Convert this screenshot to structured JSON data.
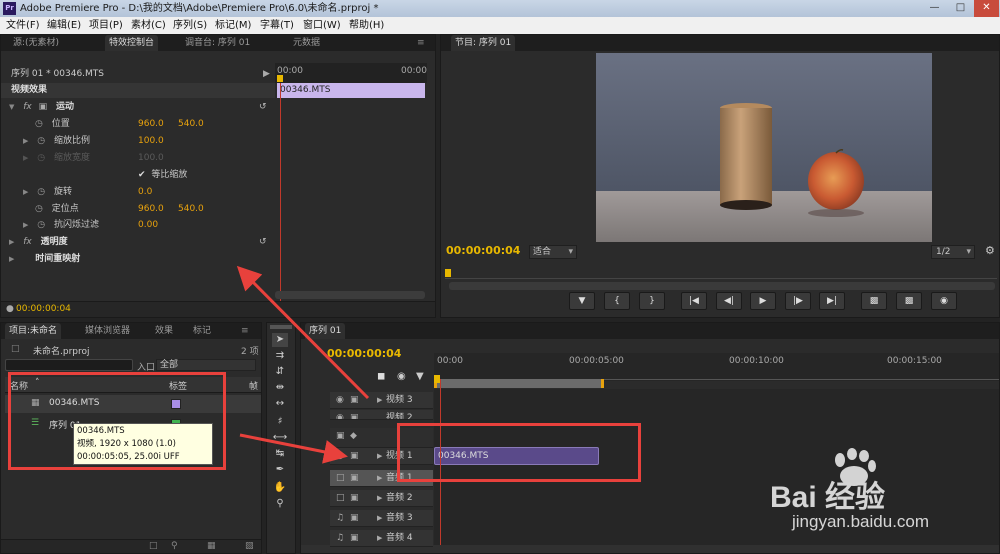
{
  "window": {
    "title": "Adobe Premiere Pro - D:\\我的文档\\Adobe\\Premiere Pro\\6.0\\未命名.prproj *",
    "logo_text": "Pr"
  },
  "menu": [
    "文件(F)",
    "编辑(E)",
    "项目(P)",
    "素材(C)",
    "序列(S)",
    "标记(M)",
    "字幕(T)",
    "窗口(W)",
    "帮助(H)"
  ],
  "source_panel": {
    "tabs": [
      "源:(无素材)",
      "特效控制台",
      "调音台: 序列 01",
      "元数据"
    ],
    "active_tab": "特效控制台",
    "header": "序列 01 * 00346.MTS",
    "ruler_start": "00:00",
    "ruler_end": "00:00",
    "clip_label": "00346.MTS",
    "section_title": "视频效果",
    "motion_label": "运动",
    "properties": [
      {
        "name": "位置",
        "v1": "960.0",
        "v2": "540.0"
      },
      {
        "name": "缩放比例",
        "v1": "100.0",
        "v2": ""
      },
      {
        "name": "缩放宽度",
        "v1": "100.0",
        "v2": ""
      },
      {
        "name": "等比缩放",
        "v1": "",
        "v2": ""
      },
      {
        "name": "旋转",
        "v1": "0.0",
        "v2": ""
      },
      {
        "name": "定位点",
        "v1": "960.0",
        "v2": "540.0"
      },
      {
        "name": "抗闪烁过滤",
        "v1": "0.00",
        "v2": ""
      }
    ],
    "opacity_label": "透明度",
    "time_remap_label": "时间重映射",
    "timecode": "00:00:00:04"
  },
  "program_panel": {
    "tab": "节目: 序列 01",
    "timecode": "00:00:00:04",
    "fit_label": "适合",
    "resolution": "1/2"
  },
  "project_panel": {
    "tabs": [
      "项目:未命名",
      "媒体浏览器",
      "效果",
      "标记"
    ],
    "count": "2 项",
    "project_file": "未命名.prproj",
    "in_label": "入口:",
    "in_value": "全部",
    "col_name": "名称",
    "col_label": "标签",
    "col_frame": "帧",
    "items": [
      {
        "name": "00346.MTS",
        "color": "#a98ee6"
      },
      {
        "name": "序列 01",
        "color": "#3fb34f"
      }
    ],
    "tooltip": {
      "line1": "00346.MTS",
      "line2": "视频, 1920 x 1080 (1.0)",
      "line3": "00:00:05:05, 25.00i UFF"
    }
  },
  "timeline": {
    "tab": "序列 01",
    "timecode": "00:00:00:04",
    "ruler": [
      "00:00",
      "00:00:05:00",
      "00:00:10:00",
      "00:00:15:00"
    ],
    "tracks": [
      "视频 3",
      "视频 2",
      "视频 1",
      "音频 1",
      "音频 2",
      "音频 3",
      "音频 4"
    ],
    "clip_label": "00346.MTS"
  },
  "watermark": {
    "brand": "Bai 经验",
    "url": "jingyan.baidu.com"
  }
}
